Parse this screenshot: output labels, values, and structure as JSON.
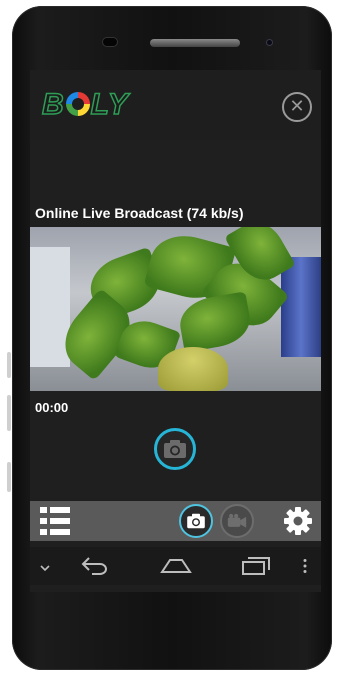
{
  "app": {
    "logo_text": "BOLY",
    "status_title": "Online Live Broadcast (74 kb/s)",
    "timer": "00:00",
    "close_glyph": "✕"
  },
  "icons": {
    "close": "close-icon",
    "snapshot": "camera-icon",
    "menu": "list-menu-icon",
    "photo_mode": "camera-icon",
    "video_mode": "video-camera-icon",
    "settings": "gear-icon",
    "nav_menu": "chevron-down-icon",
    "nav_back": "back-icon",
    "nav_home": "home-icon",
    "nav_recents": "recents-icon",
    "nav_overflow": "more-vertical-icon"
  },
  "colors": {
    "accent": "#26b5d6",
    "screen_bg": "#1f1f1f",
    "toolbar_bg": "#5a5a5a",
    "logo_green": "#2e9e56"
  }
}
